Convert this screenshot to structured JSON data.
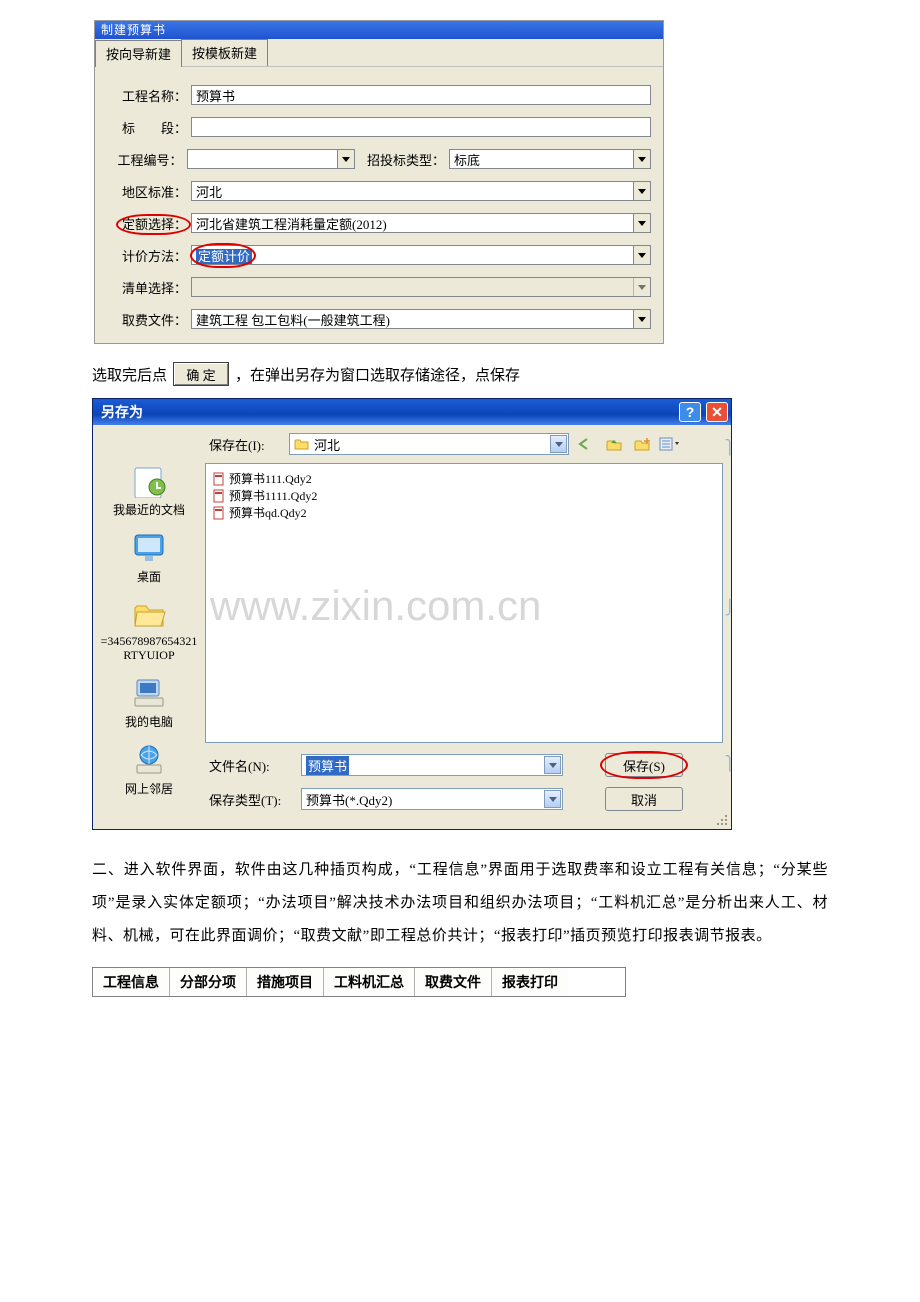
{
  "dlg1": {
    "title": "制建预算书",
    "tabs": {
      "wizard": "按向导新建",
      "template": "按模板新建"
    },
    "labels": {
      "projName": "工程名称：",
      "projNameVal": "预算书",
      "section": "标　　段：",
      "projNo": "工程编号：",
      "bidType": "招投标类型：",
      "bidTypeVal": "标底",
      "region": "地区标准：",
      "regionVal": "河北",
      "quota": "定额选择：",
      "quotaVal": "河北省建筑工程消耗量定额(2012)",
      "priceMethod": "计价方法：",
      "priceMethodVal": "定额计价",
      "list": "清单选择：",
      "feeFile": "取费文件：",
      "feeFileVal": "建筑工程 包工包料(一般建筑工程)"
    }
  },
  "line1": {
    "p1": "选取完后点",
    "ok": "确 定",
    "p2": "，在弹出另存为窗口选取存储途径，点保存"
  },
  "dlg2": {
    "title": "另存为",
    "saveInLabel": "保存在(I):",
    "saveInVal": "河北",
    "places": {
      "recent": "我最近的文档",
      "desktop": "桌面",
      "folder": "=345678987654321RTYUIOP",
      "mycomp": "我的电脑",
      "network": "网上邻居"
    },
    "files": [
      "预算书111.Qdy2",
      "预算书1111.Qdy2",
      "预算书qd.Qdy2"
    ],
    "fileNameLabel": "文件名(N):",
    "fileNameVal": "预算书",
    "fileTypeLabel": "保存类型(T):",
    "fileTypeVal": "预算书(*.Qdy2)",
    "saveBtn": "保存(S)",
    "cancelBtn": "取消"
  },
  "watermark": "www.zixin.com.cn",
  "para": " 二、进入软件界面，软件由这几种插页构成，“工程信息”界面用于选取费率和设立工程有关信息；“分某些项”是录入实体定额项；“办法项目”解决技术办法项目和组织办法项目；“工料机汇总”是分析出来人工、材料、机械，可在此界面调价；“取费文献”即工程总价共计；“报表打印”插页预览打印报表调节报表。",
  "btabs": [
    "工程信息",
    "分部分项",
    "措施项目",
    "工料机汇总",
    "取费文件",
    "报表打印"
  ]
}
